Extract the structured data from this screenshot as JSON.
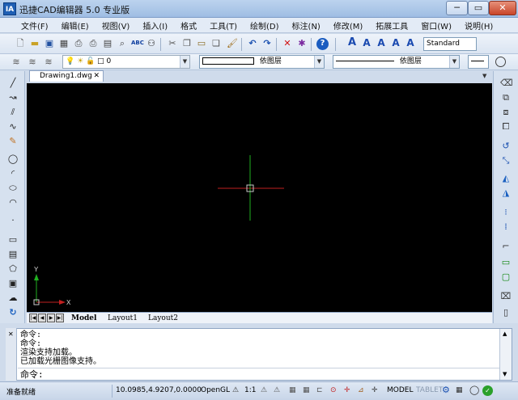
{
  "window": {
    "title": "迅捷CAD编辑器 5.0 专业版",
    "logo_text": "IA"
  },
  "window_controls": {
    "minimize": "─",
    "maximize": "▭",
    "close": "✕"
  },
  "menu": [
    "文件(F)",
    "编辑(E)",
    "视图(V)",
    "插入(I)",
    "格式",
    "工具(T)",
    "绘制(D)",
    "标注(N)",
    "修改(M)",
    "拓展工具",
    "窗口(W)",
    "说明(H)"
  ],
  "toolbar": {
    "text_style": "Standard",
    "layer_value": "0",
    "color_value": "依图层",
    "linetype_value": "依图层",
    "abc_label": "ABC"
  },
  "document_tab": {
    "name": "Drawing1.dwg",
    "close": "✕"
  },
  "layout_tabs": [
    "Model",
    "Layout1",
    "Layout2"
  ],
  "ucs": {
    "y_label": "Y",
    "x_label": "X"
  },
  "command_history": [
    "命令:",
    "命令:",
    "渲染支持加载。",
    "已加载光栅图像支持。"
  ],
  "command_prompt": "命令:",
  "status": {
    "ready": "准备就绪",
    "coords": "10.0985,4.9207,0.0000",
    "renderer": "OpenGL",
    "scale": "1:1",
    "model": "MODEL",
    "tablet": "TABLET"
  },
  "colors": {
    "crosshair_x": "#c02020",
    "crosshair_y": "#20b020",
    "canvas": "#000000"
  }
}
